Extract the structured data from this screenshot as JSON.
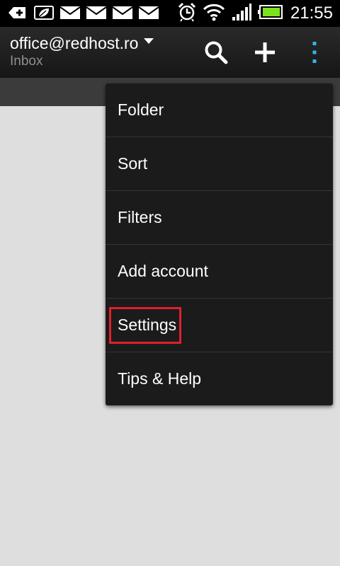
{
  "status_bar": {
    "time": "21:55",
    "left_icons": [
      "usb-debug-icon",
      "leaf-icon",
      "mail-icon",
      "mail-icon",
      "mail-icon",
      "mail-icon"
    ],
    "right_icons": [
      "alarm-icon",
      "wifi-icon",
      "signal-icon",
      "battery-icon"
    ],
    "battery_color": "#7ee21b"
  },
  "action_bar": {
    "account": "office@redhost.ro",
    "folder": "Inbox",
    "buttons": [
      "search-icon",
      "add-icon",
      "overflow-menu-icon"
    ],
    "overflow_accent": "#33b5e5"
  },
  "menu": {
    "items": [
      {
        "label": "Folder"
      },
      {
        "label": "Sort"
      },
      {
        "label": "Filters"
      },
      {
        "label": "Add account"
      },
      {
        "label": "Settings"
      },
      {
        "label": "Tips & Help"
      }
    ],
    "highlighted_item": "Settings",
    "highlight_color": "#e0202a"
  }
}
